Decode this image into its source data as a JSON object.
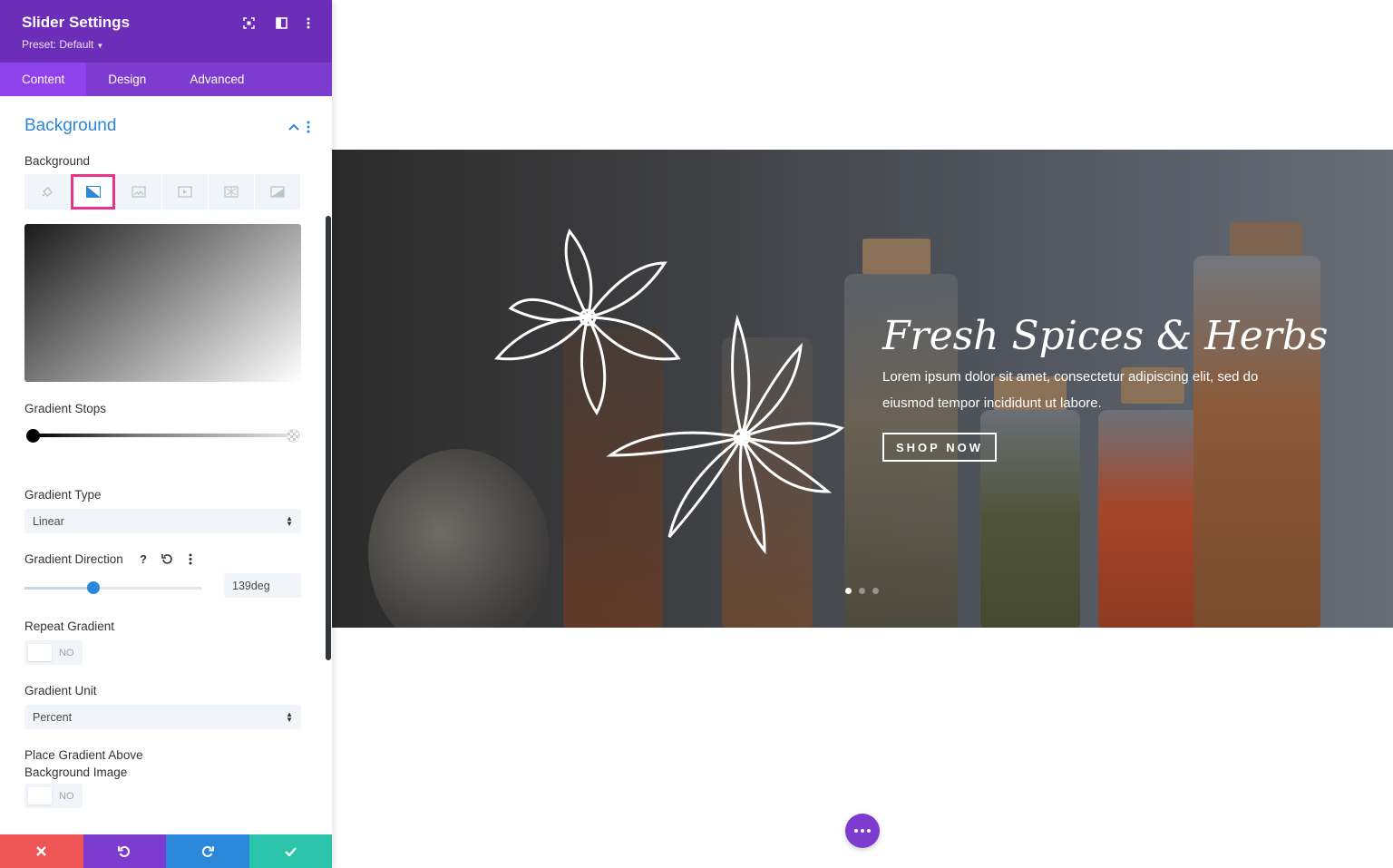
{
  "panel": {
    "title": "Slider Settings",
    "preset": "Preset: Default",
    "header_icons": [
      "expand-icon",
      "split-view-icon",
      "more-vertical-icon"
    ]
  },
  "tabs": [
    {
      "label": "Content",
      "active": true
    },
    {
      "label": "Design",
      "active": false
    },
    {
      "label": "Advanced",
      "active": false
    }
  ],
  "section": {
    "title": "Background",
    "background_label": "Background",
    "background_types": [
      "color-icon",
      "gradient-icon",
      "image-icon",
      "video-icon",
      "pattern-icon",
      "mask-icon"
    ],
    "active_type": "gradient-icon"
  },
  "gradient": {
    "stops_label": "Gradient Stops",
    "type_label": "Gradient Type",
    "type_value": "Linear",
    "direction_label": "Gradient Direction",
    "direction_value": "139deg",
    "direction_fraction": 0.39,
    "repeat_label": "Repeat Gradient",
    "repeat_value": "NO",
    "unit_label": "Gradient Unit",
    "unit_value": "Percent",
    "place_above_label": "Place Gradient Above Background Image",
    "place_above_value": "NO"
  },
  "footer": {
    "buttons": [
      "close-icon",
      "undo-icon",
      "redo-icon",
      "save-icon"
    ],
    "colors": [
      "#ef5555",
      "#7e3bd0",
      "#2b87da",
      "#29c4a9"
    ]
  },
  "slide": {
    "heading": "Fresh Spices & Herbs",
    "text": "Lorem ipsum dolor sit amet, consectetur adipiscing elit, sed do eiusmod tempor incididunt ut labore.",
    "button": "SHOP NOW",
    "dots_total": 3,
    "dots_active": 1
  },
  "colors": {
    "header": "#6c2eb9",
    "accent_blue": "#2b87da",
    "highlight": "#e9328a"
  }
}
